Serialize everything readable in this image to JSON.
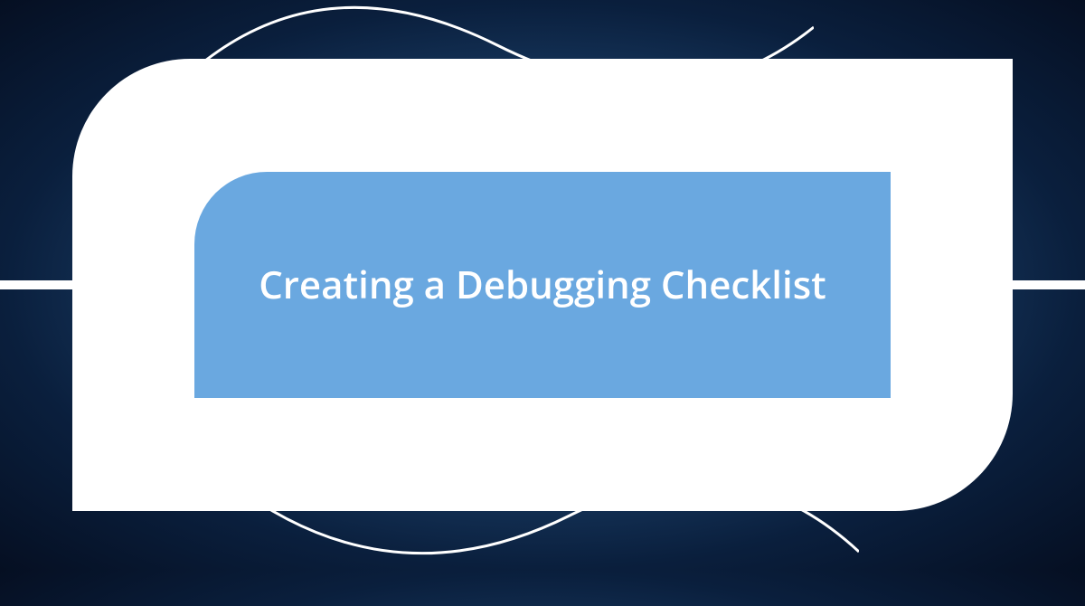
{
  "title": "Creating a Debugging Checklist",
  "colors": {
    "innerShape": "#6aa8e0",
    "outerShape": "#ffffff",
    "backgroundDark": "#050f22",
    "backgroundMid": "#1e4570"
  }
}
